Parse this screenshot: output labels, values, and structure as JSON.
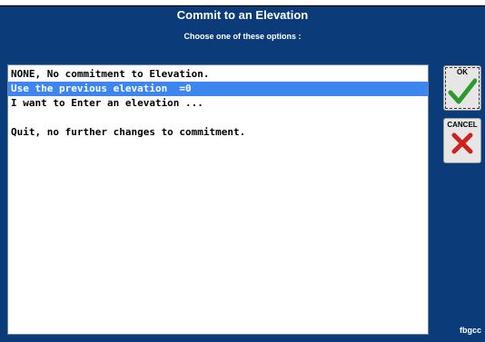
{
  "dialog": {
    "title": "Commit to an Elevation",
    "subtitle": "Choose one of these options :"
  },
  "options": [
    {
      "label": "NONE, No commitment to Elevation.",
      "selected": false
    },
    {
      "label": "Use the previous elevation  =0",
      "selected": true
    },
    {
      "label": "I want to Enter an elevation ...",
      "selected": false
    },
    {
      "label": "",
      "selected": false
    },
    {
      "label": "Quit, no further changes to commitment.",
      "selected": false
    }
  ],
  "buttons": {
    "ok_label": "OK",
    "cancel_label": "CANCEL"
  },
  "footer": {
    "text": "fbgcc"
  },
  "colors": {
    "background": "#0b3c79",
    "selection": "#3d86f0",
    "ok_check": "#2e9a2e",
    "cancel_x": "#d0221d"
  }
}
